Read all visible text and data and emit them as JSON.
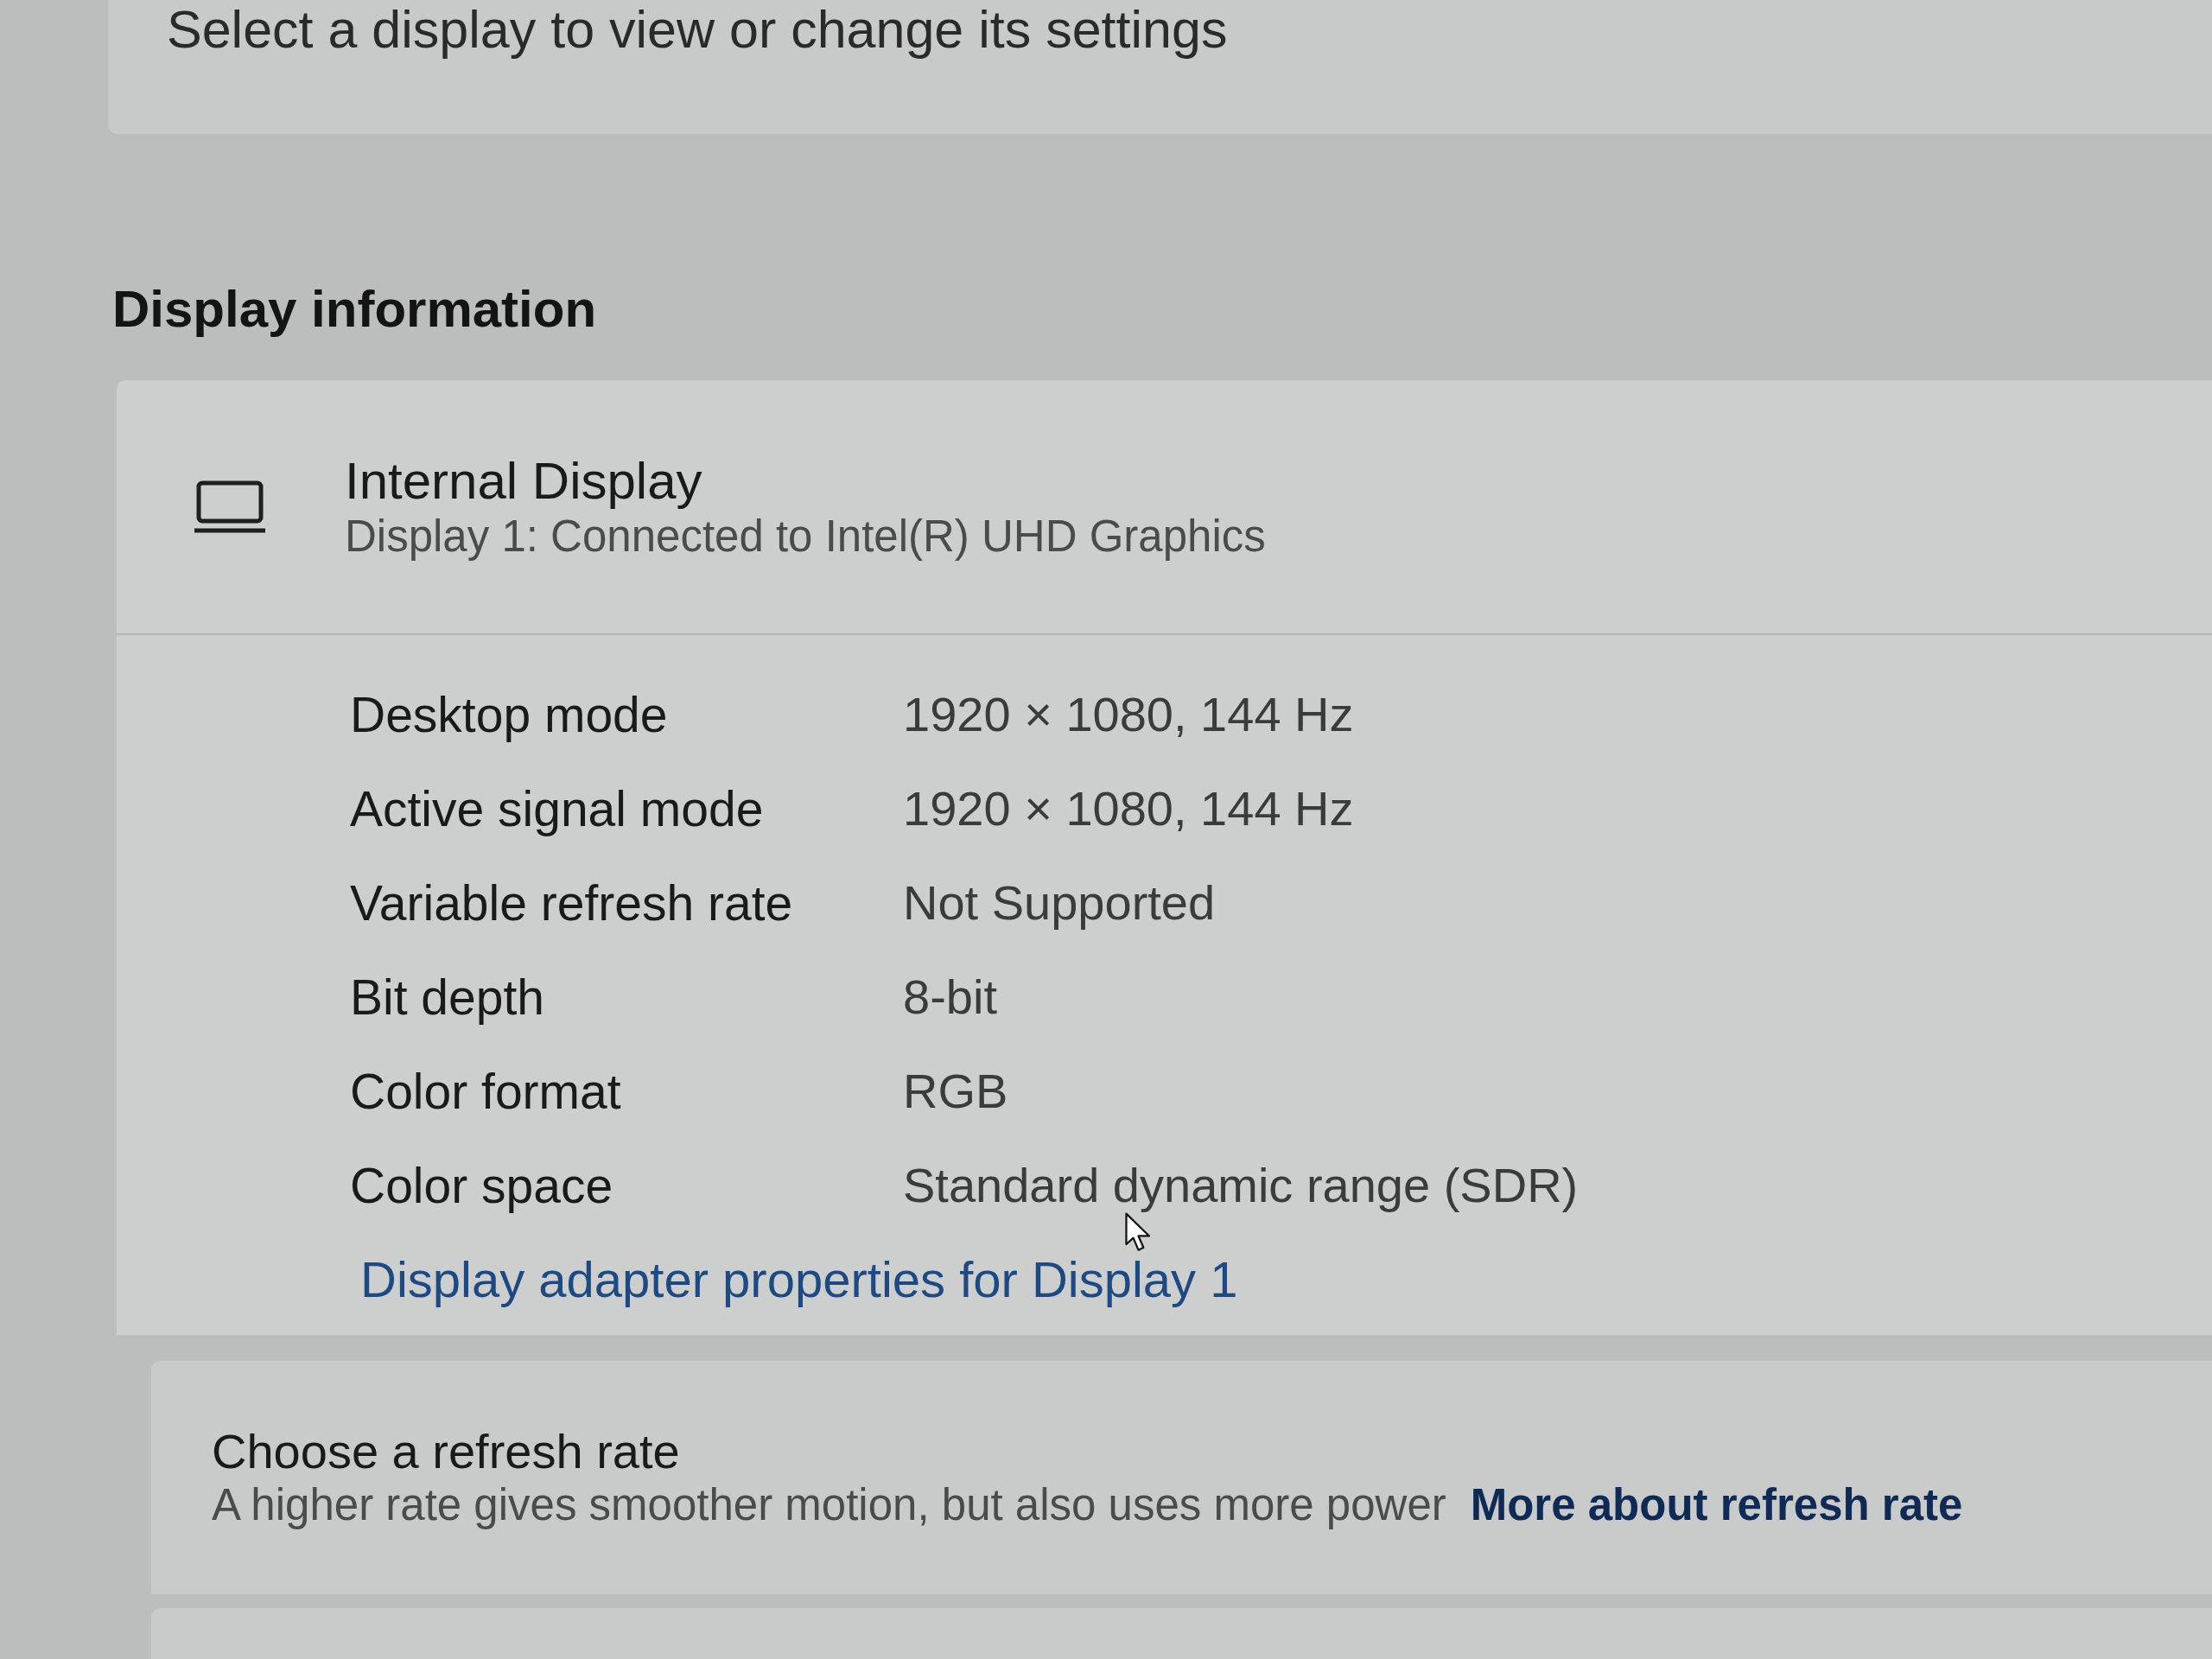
{
  "display_selector": {
    "caption": "Select a display to view or change its settings"
  },
  "display_information": {
    "heading": "Display information",
    "display": {
      "name": "Internal Display",
      "description": "Display 1: Connected to Intel(R) UHD Graphics"
    },
    "properties": [
      {
        "label": "Desktop mode",
        "value": "1920 × 1080, 144 Hz"
      },
      {
        "label": "Active signal mode",
        "value": "1920 × 1080, 144 Hz"
      },
      {
        "label": "Variable refresh rate",
        "value": "Not Supported"
      },
      {
        "label": "Bit depth",
        "value": "8-bit"
      },
      {
        "label": "Color format",
        "value": "RGB"
      },
      {
        "label": "Color space",
        "value": "Standard dynamic range (SDR)"
      }
    ],
    "adapter_link": "Display adapter properties for Display 1"
  },
  "refresh_rate": {
    "title": "Choose a refresh rate",
    "description": "A higher rate gives smoother motion, but also uses more power",
    "link": "More about refresh rate"
  }
}
